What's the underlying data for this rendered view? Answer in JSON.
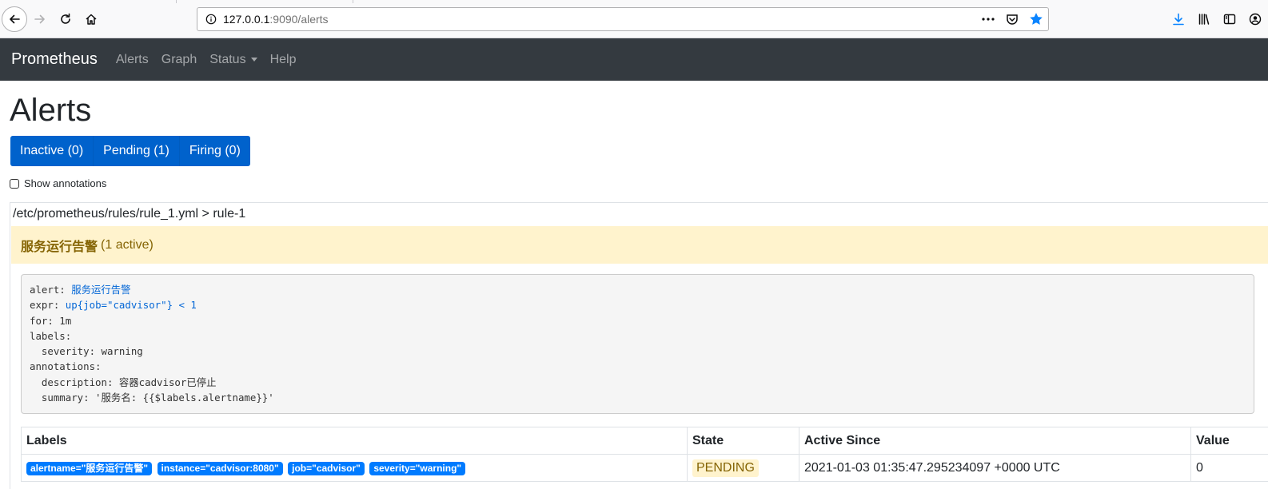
{
  "browser": {
    "url_host": "127.0.0.1",
    "url_rest": ":9090/alerts",
    "icons": [
      "back-icon",
      "forward-icon",
      "reload-icon",
      "home-icon",
      "info-icon",
      "more-icon",
      "pocket-icon",
      "bookmark-star-icon",
      "download-icon",
      "library-icon",
      "sidebar-icon",
      "account-icon"
    ]
  },
  "navbar": {
    "brand": "Prometheus",
    "links": [
      "Alerts",
      "Graph",
      "Status",
      "Help"
    ]
  },
  "page": {
    "title": "Alerts",
    "state_filters": [
      "Inactive (0)",
      "Pending (1)",
      "Firing (0)"
    ],
    "show_annotations": "Show annotations"
  },
  "rule_group": {
    "file": "/etc/prometheus/rules/rule_1.yml > rule-1",
    "alert_name": "服务运行告警",
    "alert_count": "(1 active)",
    "rule_lines": {
      "alert_key": "alert: ",
      "alert_val": "服务运行告警",
      "expr_key": "expr: ",
      "expr_val": "up{job=\"cadvisor\"} < 1",
      "for": "for: 1m",
      "labels": "labels:",
      "severity": "  severity: warning",
      "annotations": "annotations:",
      "description": "  description: 容器cadvisor已停止",
      "summary": "  summary: '服务名: {{$labels.alertname}}'"
    },
    "table": {
      "headers": [
        "Labels",
        "State",
        "Active Since",
        "Value"
      ],
      "row": {
        "labels": [
          "alertname=\"服务运行告警\"",
          "instance=\"cadvisor:8080\"",
          "job=\"cadvisor\"",
          "severity=\"warning\""
        ],
        "state": "PENDING",
        "active_since": "2021-01-03 01:35:47.295234097 +0000 UTC",
        "value": "0"
      }
    }
  },
  "colors": {
    "navbar_bg": "#343a40",
    "primary": "#0062cc",
    "warning_bg": "#fff3cd",
    "warning_text": "#856404",
    "badge": "#007bff"
  }
}
